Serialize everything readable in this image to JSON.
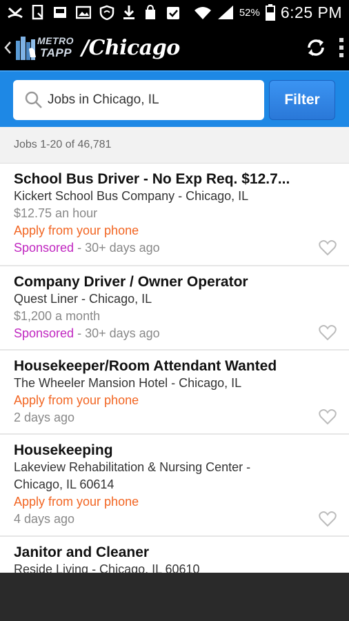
{
  "status_bar": {
    "battery_percent": "52%",
    "time": "6:25 PM"
  },
  "app_bar": {
    "logo_text_top": "METRO",
    "logo_text_bottom": "TAPP",
    "city": "/Chicago"
  },
  "search": {
    "query": "Jobs in Chicago, IL",
    "filter_label": "Filter"
  },
  "results": {
    "count_label": "Jobs 1-20 of 46,781"
  },
  "jobs": [
    {
      "title": "School Bus Driver - No Exp Req. $12.7...",
      "company": "Kickert School Bus Company - Chicago, IL",
      "salary": "$12.75 an hour",
      "apply": "Apply from your phone",
      "sponsored": "Sponsored",
      "age": " - 30+ days ago"
    },
    {
      "title": "Company Driver / Owner Operator",
      "company": "Quest Liner - Chicago, IL",
      "salary": "$1,200 a month",
      "sponsored": "Sponsored",
      "age": " - 30+ days ago"
    },
    {
      "title": "Housekeeper/Room Attendant Wanted",
      "company": "The Wheeler Mansion Hotel - Chicago, IL",
      "apply": "Apply from your phone",
      "age": "2 days ago"
    },
    {
      "title": "Housekeeping",
      "company_line1": "Lakeview Rehabilitation & Nursing Center -",
      "company_line2": "Chicago, IL 60614",
      "apply": "Apply from your phone",
      "age": "4 days ago"
    },
    {
      "title": "Janitor and Cleaner",
      "company": "Reside Living - Chicago, IL 60610"
    }
  ],
  "colors": {
    "search_bar_bg": "#1e88e5",
    "apply_text": "#f26522",
    "sponsored_text": "#c026c0"
  },
  "icons": {
    "back": "chevron-left-icon",
    "refresh": "refresh-icon",
    "overflow": "overflow-menu-icon",
    "search": "search-icon",
    "save": "heart-icon"
  }
}
